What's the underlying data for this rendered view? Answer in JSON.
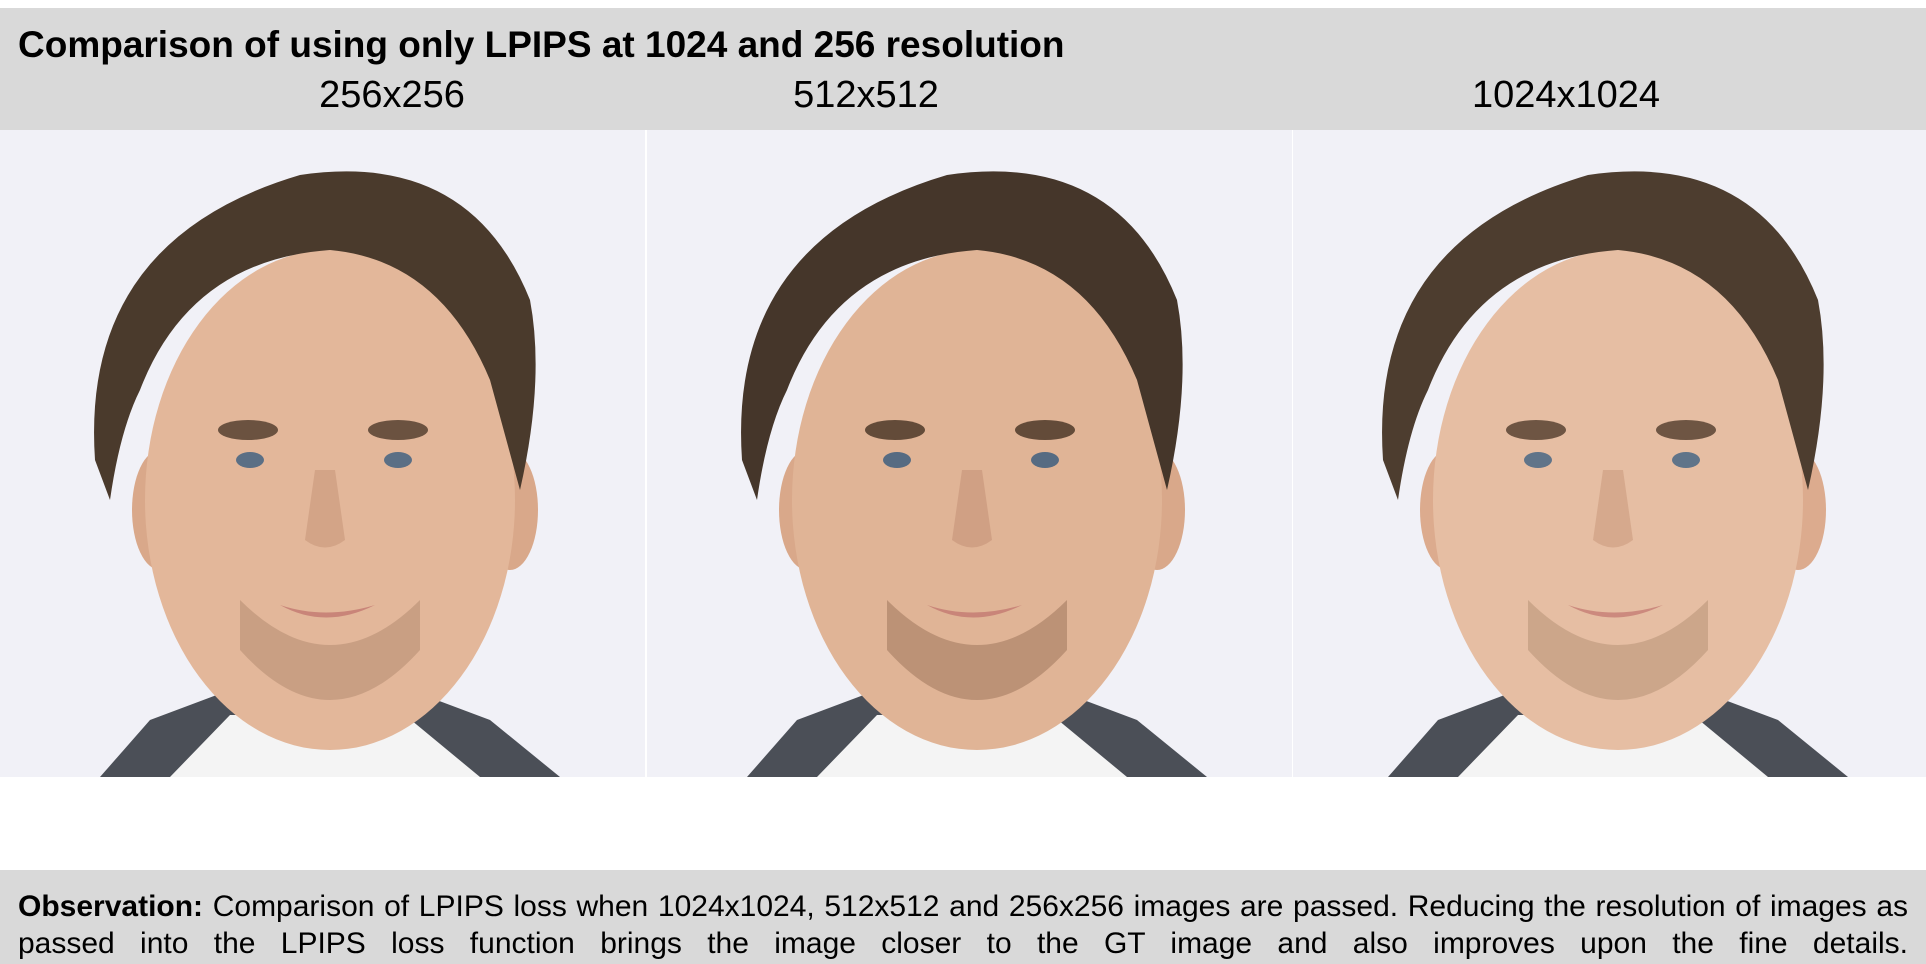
{
  "title": "Comparison of using only LPIPS at 1024 and 256 resolution",
  "columns": [
    {
      "label": "256x256"
    },
    {
      "label": "512x512"
    },
    {
      "label": "1024x1024"
    }
  ],
  "observation": {
    "label": "Observation:",
    "text": "Comparison of LPIPS loss when 1024x1024, 512x512 and 256x256 images are passed. Reducing the resolution of images as passed into the LPIPS loss function brings the image closer to the GT image and also improves upon the fine details."
  },
  "colors": {
    "band": "#d9d9d9",
    "portrait_bg": "#f2f2f8",
    "hair": "#4a3a2c",
    "skin": "#e3b79a",
    "jacket": "#4b4f57"
  }
}
